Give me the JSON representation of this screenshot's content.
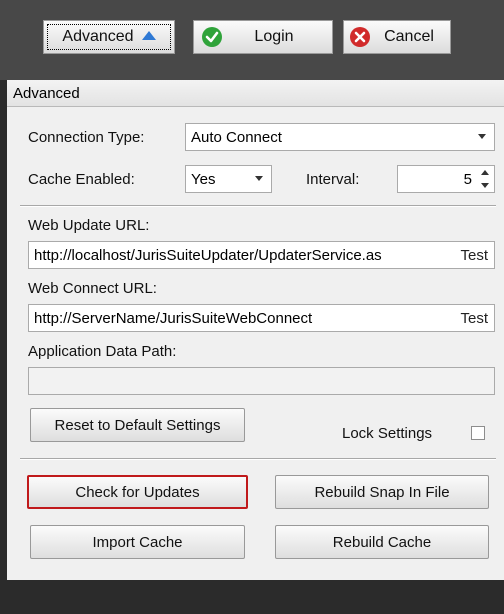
{
  "toolbar": {
    "advanced_label": "Advanced",
    "login_label": "Login",
    "cancel_label": "Cancel"
  },
  "panel": {
    "header": "Advanced"
  },
  "form": {
    "connection_type_label": "Connection Type:",
    "connection_type_value": "Auto Connect",
    "cache_enabled_label": "Cache Enabled:",
    "cache_enabled_value": "Yes",
    "interval_label": "Interval:",
    "interval_value": "5",
    "web_update_label": "Web Update URL:",
    "web_update_value": "http://localhost/JurisSuiteUpdater/UpdaterService.as",
    "web_update_test": "Test",
    "web_connect_label": "Web Connect URL:",
    "web_connect_value": "http://ServerName/JurisSuiteWebConnect",
    "web_connect_test": "Test",
    "app_data_label": "Application Data Path:",
    "app_data_value": "",
    "reset_label": "Reset to Default Settings",
    "lock_settings_label": "Lock Settings",
    "lock_settings_checked": false
  },
  "actions": {
    "check_updates": "Check for Updates",
    "rebuild_snapin": "Rebuild Snap In File",
    "import_cache": "Import Cache",
    "rebuild_cache": "Rebuild Cache"
  },
  "colors": {
    "accent_blue": "#2f79d4",
    "check_green": "#2fa33a",
    "cancel_red": "#d12b2b",
    "primary_border": "#c0191b"
  }
}
